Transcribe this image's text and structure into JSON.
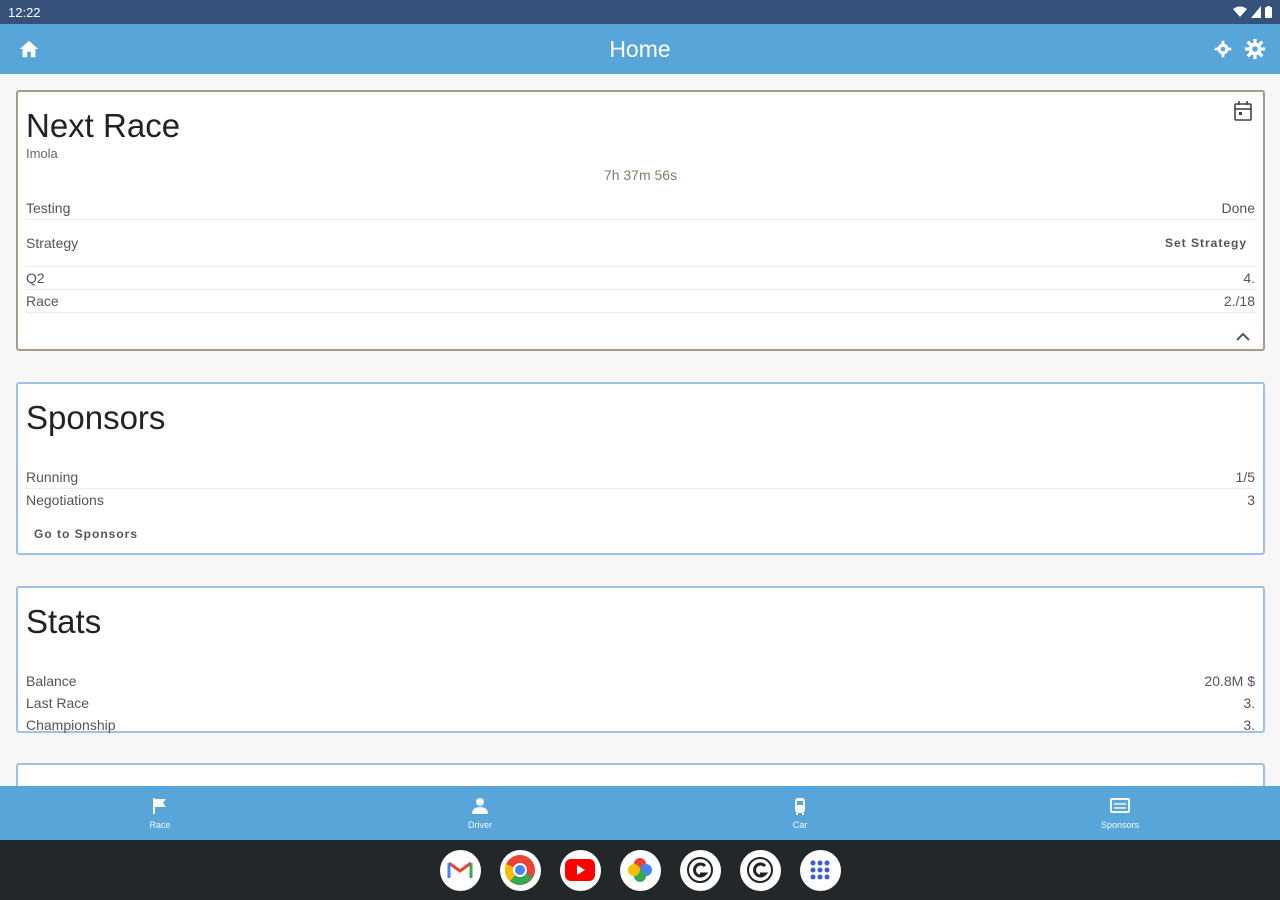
{
  "status_bar": {
    "time": "12:22"
  },
  "app_bar": {
    "title": "Home"
  },
  "next_race": {
    "title": "Next Race",
    "track": "Imola",
    "countdown": "7h 37m 56s",
    "rows": [
      {
        "label": "Testing",
        "value": "Done"
      },
      {
        "label": "Strategy",
        "action": "Set Strategy"
      },
      {
        "label": "Q2",
        "value": "4."
      },
      {
        "label": "Race",
        "value": "2./18"
      }
    ]
  },
  "sponsors": {
    "title": "Sponsors",
    "rows": [
      {
        "label": "Running",
        "value": "1/5"
      },
      {
        "label": "Negotiations",
        "value": "3"
      }
    ],
    "action": "Go to Sponsors"
  },
  "stats": {
    "title": "Stats",
    "rows": [
      {
        "label": "Balance",
        "value": "20.8M $"
      },
      {
        "label": "Last Race",
        "value": "3."
      },
      {
        "label": "Championship",
        "value": "3."
      }
    ]
  },
  "bottom_nav": {
    "items": [
      {
        "label": "Race",
        "icon": "flag-icon"
      },
      {
        "label": "Driver",
        "icon": "person-icon"
      },
      {
        "label": "Car",
        "icon": "car-icon"
      },
      {
        "label": "Sponsors",
        "icon": "billboard-icon"
      }
    ]
  },
  "dock": {
    "apps": [
      "gmail-icon",
      "chrome-icon",
      "youtube-icon",
      "photos-icon",
      "app-icon",
      "app-icon",
      "app-drawer-icon"
    ]
  },
  "colors": {
    "status_bar": "#36517a",
    "app_bar": "#58a5da",
    "card_border": "#9ec2e4",
    "race_card_border": "#a89a8a",
    "dock": "#22272a"
  }
}
